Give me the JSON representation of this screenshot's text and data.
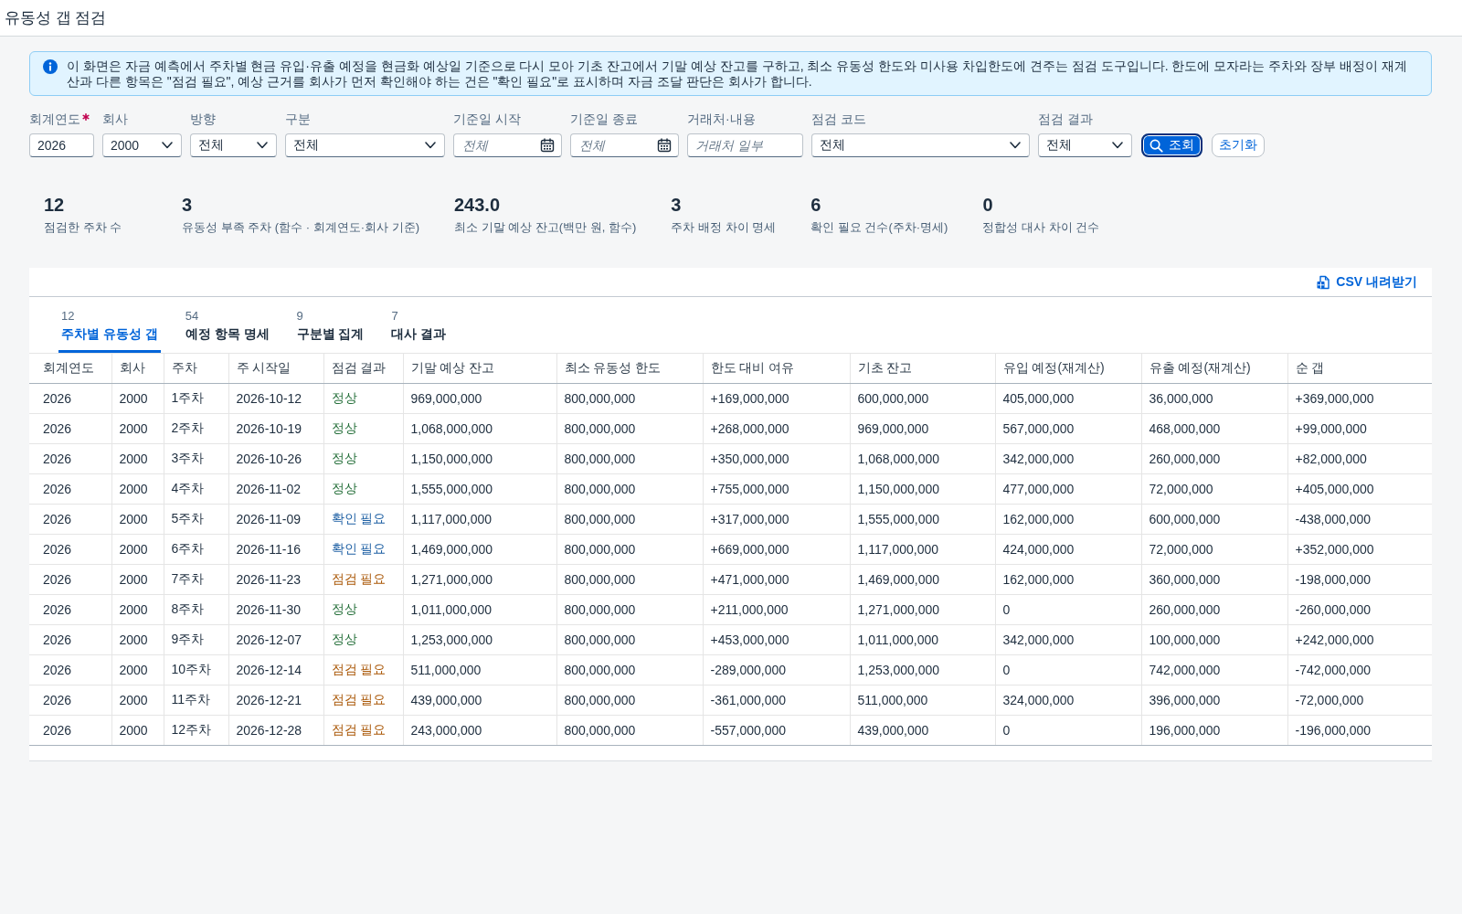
{
  "window": {
    "title": "유동성 갭 점검"
  },
  "info_message": {
    "text": "이 화면은 자금 예측에서 주차별 현금 유입·유출 예정을 현금화 예상일 기준으로 다시 모아 기초 잔고에서 기말 예상 잔고를 구하고, 최소 유동성 한도와 미사용 차입한도에 견주는 점검 도구입니다. 한도에 모자라는 주차와 장부 배정이 재계산과 다른 항목은 \"점검 필요\", 예상 근거를 회사가 먼저 확인해야 하는 건은 \"확인 필요\"로 표시하며 자금 조달 판단은 회사가 합니다."
  },
  "filters": [
    {
      "label": "회계연도",
      "required": true,
      "kind": "text",
      "value": "2026"
    },
    {
      "label": "회사",
      "required": false,
      "kind": "select",
      "value": "2000"
    },
    {
      "label": "방향",
      "required": false,
      "kind": "select",
      "value": "전체"
    },
    {
      "label": "구분",
      "required": false,
      "kind": "select",
      "value": "전체"
    },
    {
      "label": "기준일 시작",
      "required": false,
      "kind": "date",
      "placeholder": "전체"
    },
    {
      "label": "기준일 종료",
      "required": false,
      "kind": "date",
      "placeholder": "전체"
    },
    {
      "label": "거래처·내용",
      "required": false,
      "kind": "text",
      "placeholder": "거래처 일부"
    },
    {
      "label": "점검 코드",
      "required": false,
      "kind": "select",
      "value": "전체"
    },
    {
      "label": "점검 결과",
      "required": false,
      "kind": "select",
      "value": "전체"
    }
  ],
  "buttons": [
    {
      "label": "조회",
      "kind": "search",
      "focused": true
    },
    {
      "label": "초기화",
      "kind": "reset",
      "focused": false
    }
  ],
  "kpis": [
    {
      "value": "12",
      "label": "점검한 주차 수"
    },
    {
      "value": "3",
      "label": "유동성 부족 주차 (함수 · 회계연도·회사 기준)"
    },
    {
      "value": "243.0",
      "label": "최소 기말 예상 잔고(백만 원, 함수)"
    },
    {
      "value": "3",
      "label": "주차 배정 차이 명세"
    },
    {
      "value": "6",
      "label": "확인 필요 건수(주차·명세)"
    },
    {
      "value": "0",
      "label": "정합성 대사 차이 건수"
    }
  ],
  "panel": {
    "download_button": "CSV 내려받기",
    "tabs": [
      {
        "count": "12",
        "label": "주차별 유동성 갭",
        "selected": true
      },
      {
        "count": "54",
        "label": "예정 항목 명세",
        "selected": false
      },
      {
        "count": "9",
        "label": "구분별 집계",
        "selected": false
      },
      {
        "count": "7",
        "label": "대사 결과",
        "selected": false
      }
    ],
    "table": {
      "columns": [
        {
          "label": "회계연도",
          "kind": "text"
        },
        {
          "label": "회사",
          "kind": "text"
        },
        {
          "label": "주차",
          "kind": "text"
        },
        {
          "label": "주 시작일",
          "kind": "text"
        },
        {
          "label": "점검 결과",
          "kind": "status"
        },
        {
          "label": "기말 예상 잔고",
          "kind": "text"
        },
        {
          "label": "최소 유동성 한도",
          "kind": "text"
        },
        {
          "label": "한도 대비 여유",
          "kind": "text"
        },
        {
          "label": "기초 잔고",
          "kind": "text"
        },
        {
          "label": "유입 예정(재계산)",
          "kind": "text"
        },
        {
          "label": "유출 예정(재계산)",
          "kind": "text"
        },
        {
          "label": "순 갭",
          "kind": "text"
        }
      ],
      "rows": [
        {
          "color": "#256f3a",
          "cells": [
            "2026",
            "2000",
            "1주차",
            "2026-10-12",
            "정상",
            "969,000,000",
            "800,000,000",
            "+169,000,000",
            "600,000,000",
            "405,000,000",
            "36,000,000",
            "+369,000,000"
          ]
        },
        {
          "color": "#256f3a",
          "cells": [
            "2026",
            "2000",
            "2주차",
            "2026-10-19",
            "정상",
            "1,068,000,000",
            "800,000,000",
            "+268,000,000",
            "969,000,000",
            "567,000,000",
            "468,000,000",
            "+99,000,000"
          ]
        },
        {
          "color": "#256f3a",
          "cells": [
            "2026",
            "2000",
            "3주차",
            "2026-10-26",
            "정상",
            "1,150,000,000",
            "800,000,000",
            "+350,000,000",
            "1,068,000,000",
            "342,000,000",
            "260,000,000",
            "+82,000,000"
          ]
        },
        {
          "color": "#256f3a",
          "cells": [
            "2026",
            "2000",
            "4주차",
            "2026-11-02",
            "정상",
            "1,555,000,000",
            "800,000,000",
            "+755,000,000",
            "1,150,000,000",
            "477,000,000",
            "72,000,000",
            "+405,000,000"
          ]
        },
        {
          "color": "#1d5fa3",
          "cells": [
            "2026",
            "2000",
            "5주차",
            "2026-11-09",
            "확인 필요",
            "1,117,000,000",
            "800,000,000",
            "+317,000,000",
            "1,555,000,000",
            "162,000,000",
            "600,000,000",
            "-438,000,000"
          ]
        },
        {
          "color": "#1d5fa3",
          "cells": [
            "2026",
            "2000",
            "6주차",
            "2026-11-16",
            "확인 필요",
            "1,469,000,000",
            "800,000,000",
            "+669,000,000",
            "1,117,000,000",
            "424,000,000",
            "72,000,000",
            "+352,000,000"
          ]
        },
        {
          "color": "#aa5808",
          "cells": [
            "2026",
            "2000",
            "7주차",
            "2026-11-23",
            "점검 필요",
            "1,271,000,000",
            "800,000,000",
            "+471,000,000",
            "1,469,000,000",
            "162,000,000",
            "360,000,000",
            "-198,000,000"
          ]
        },
        {
          "color": "#256f3a",
          "cells": [
            "2026",
            "2000",
            "8주차",
            "2026-11-30",
            "정상",
            "1,011,000,000",
            "800,000,000",
            "+211,000,000",
            "1,271,000,000",
            "0",
            "260,000,000",
            "-260,000,000"
          ]
        },
        {
          "color": "#256f3a",
          "cells": [
            "2026",
            "2000",
            "9주차",
            "2026-12-07",
            "정상",
            "1,253,000,000",
            "800,000,000",
            "+453,000,000",
            "1,011,000,000",
            "342,000,000",
            "100,000,000",
            "+242,000,000"
          ]
        },
        {
          "color": "#aa5808",
          "cells": [
            "2026",
            "2000",
            "10주차",
            "2026-12-14",
            "점검 필요",
            "511,000,000",
            "800,000,000",
            "-289,000,000",
            "1,253,000,000",
            "0",
            "742,000,000",
            "-742,000,000"
          ]
        },
        {
          "color": "#aa5808",
          "cells": [
            "2026",
            "2000",
            "11주차",
            "2026-12-21",
            "점검 필요",
            "439,000,000",
            "800,000,000",
            "-361,000,000",
            "511,000,000",
            "324,000,000",
            "396,000,000",
            "-72,000,000"
          ]
        },
        {
          "color": "#aa5808",
          "cells": [
            "2026",
            "2000",
            "12주차",
            "2026-12-28",
            "점검 필요",
            "243,000,000",
            "800,000,000",
            "-557,000,000",
            "439,000,000",
            "0",
            "196,000,000",
            "-196,000,000"
          ]
        }
      ]
    }
  }
}
